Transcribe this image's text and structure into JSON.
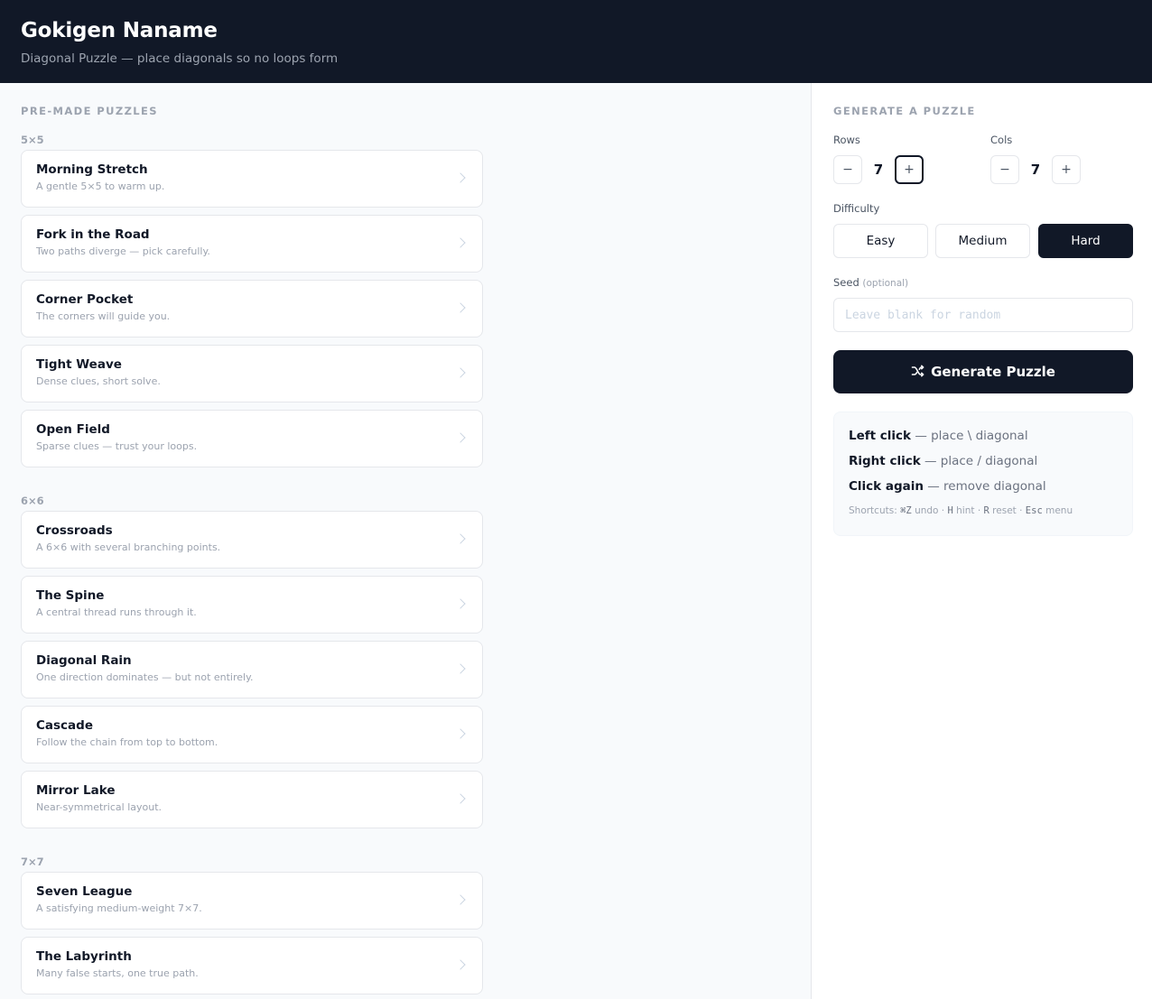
{
  "header": {
    "title": "Gokigen Naname",
    "subtitle": "Diagonal Puzzle — place diagonals so no loops form"
  },
  "premade": {
    "section_title": "PRE-MADE PUZZLES",
    "groups": [
      {
        "label": "5×5",
        "puzzles": [
          {
            "title": "Morning Stretch",
            "desc": "A gentle 5×5 to warm up."
          },
          {
            "title": "Fork in the Road",
            "desc": "Two paths diverge — pick carefully."
          },
          {
            "title": "Corner Pocket",
            "desc": "The corners will guide you."
          },
          {
            "title": "Tight Weave",
            "desc": "Dense clues, short solve."
          },
          {
            "title": "Open Field",
            "desc": "Sparse clues — trust your loops."
          }
        ]
      },
      {
        "label": "6×6",
        "puzzles": [
          {
            "title": "Crossroads",
            "desc": "A 6×6 with several branching points."
          },
          {
            "title": "The Spine",
            "desc": "A central thread runs through it."
          },
          {
            "title": "Diagonal Rain",
            "desc": "One direction dominates — but not entirely."
          },
          {
            "title": "Cascade",
            "desc": "Follow the chain from top to bottom."
          },
          {
            "title": "Mirror Lake",
            "desc": "Near-symmetrical layout."
          }
        ]
      },
      {
        "label": "7×7",
        "puzzles": [
          {
            "title": "Seven League",
            "desc": "A satisfying medium-weight 7×7."
          },
          {
            "title": "The Labyrinth",
            "desc": "Many false starts, one true path."
          }
        ]
      }
    ]
  },
  "generator": {
    "section_title": "GENERATE A PUZZLE",
    "rows_label": "Rows",
    "rows_value": "7",
    "cols_label": "Cols",
    "cols_value": "7",
    "minus": "−",
    "plus": "+",
    "difficulty_label": "Difficulty",
    "difficulties": [
      "Easy",
      "Medium",
      "Hard"
    ],
    "selected_difficulty": "Hard",
    "seed_label": "Seed",
    "seed_optional": "(optional)",
    "seed_placeholder": "Leave blank for random",
    "generate_label": "Generate Puzzle"
  },
  "help": {
    "left_click": "Left click",
    "left_click_text": " — place \\ diagonal",
    "right_click": "Right click",
    "right_click_text": " — place / diagonal",
    "click_again": "Click again",
    "click_again_text": " — remove diagonal",
    "shortcuts_prefix": "Shortcuts: ",
    "undo_key": "⌘Z",
    "undo_text": " undo · ",
    "hint_key": "H",
    "hint_text": " hint · ",
    "reset_key": "R",
    "reset_text": " reset · ",
    "menu_key": "Esc",
    "menu_text": " menu"
  },
  "colors": {
    "header_bg": "#111827",
    "accent": "#111827",
    "muted": "#9ca3af",
    "border": "#e5e7eb"
  }
}
